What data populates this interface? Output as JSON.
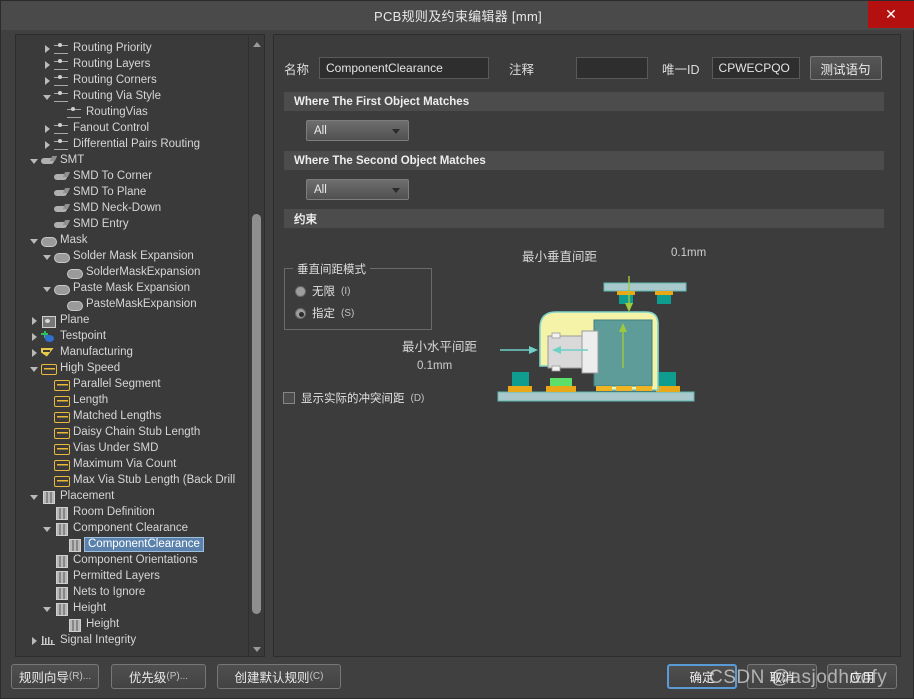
{
  "window": {
    "title": "PCB规则及约束编辑器 [mm]",
    "close_label": "✕"
  },
  "tree": {
    "items": [
      {
        "label": "Routing Priority",
        "indent": 3,
        "arrow": "closed",
        "icon": "route"
      },
      {
        "label": "Routing Layers",
        "indent": 3,
        "arrow": "closed",
        "icon": "route"
      },
      {
        "label": "Routing Corners",
        "indent": 3,
        "arrow": "closed",
        "icon": "route"
      },
      {
        "label": "Routing Via Style",
        "indent": 3,
        "arrow": "open",
        "icon": "route"
      },
      {
        "label": "RoutingVias",
        "indent": 4,
        "arrow": "none",
        "icon": "route"
      },
      {
        "label": "Fanout Control",
        "indent": 3,
        "arrow": "closed",
        "icon": "route"
      },
      {
        "label": "Differential Pairs Routing",
        "indent": 3,
        "arrow": "closed",
        "icon": "route"
      },
      {
        "label": "SMT",
        "indent": 2,
        "arrow": "open",
        "icon": "smd"
      },
      {
        "label": "SMD To Corner",
        "indent": 3,
        "arrow": "none",
        "icon": "smd"
      },
      {
        "label": "SMD To Plane",
        "indent": 3,
        "arrow": "none",
        "icon": "smd"
      },
      {
        "label": "SMD Neck-Down",
        "indent": 3,
        "arrow": "none",
        "icon": "smd"
      },
      {
        "label": "SMD Entry",
        "indent": 3,
        "arrow": "none",
        "icon": "smd"
      },
      {
        "label": "Mask",
        "indent": 2,
        "arrow": "open",
        "icon": "mask"
      },
      {
        "label": "Solder Mask Expansion",
        "indent": 3,
        "arrow": "open",
        "icon": "mask"
      },
      {
        "label": "SolderMaskExpansion",
        "indent": 4,
        "arrow": "none",
        "icon": "mask"
      },
      {
        "label": "Paste Mask Expansion",
        "indent": 3,
        "arrow": "open",
        "icon": "mask"
      },
      {
        "label": "PasteMaskExpansion",
        "indent": 4,
        "arrow": "none",
        "icon": "mask"
      },
      {
        "label": "Plane",
        "indent": 2,
        "arrow": "closed",
        "icon": "plane"
      },
      {
        "label": "Testpoint",
        "indent": 2,
        "arrow": "closed",
        "icon": "testpoint"
      },
      {
        "label": "Manufacturing",
        "indent": 2,
        "arrow": "closed",
        "icon": "manu"
      },
      {
        "label": "High Speed",
        "indent": 2,
        "arrow": "open",
        "icon": "hs"
      },
      {
        "label": "Parallel Segment",
        "indent": 3,
        "arrow": "none",
        "icon": "hs"
      },
      {
        "label": "Length",
        "indent": 3,
        "arrow": "none",
        "icon": "hs"
      },
      {
        "label": "Matched Lengths",
        "indent": 3,
        "arrow": "none",
        "icon": "hs"
      },
      {
        "label": "Daisy Chain Stub Length",
        "indent": 3,
        "arrow": "none",
        "icon": "hs"
      },
      {
        "label": "Vias Under SMD",
        "indent": 3,
        "arrow": "none",
        "icon": "hs"
      },
      {
        "label": "Maximum Via Count",
        "indent": 3,
        "arrow": "none",
        "icon": "hs"
      },
      {
        "label": "Max Via Stub Length (Back Drill",
        "indent": 3,
        "arrow": "none",
        "icon": "hs"
      },
      {
        "label": "Placement",
        "indent": 2,
        "arrow": "open",
        "icon": "place"
      },
      {
        "label": "Room Definition",
        "indent": 3,
        "arrow": "none",
        "icon": "place"
      },
      {
        "label": "Component Clearance",
        "indent": 3,
        "arrow": "open",
        "icon": "place"
      },
      {
        "label": "ComponentClearance",
        "indent": 4,
        "arrow": "none",
        "icon": "place",
        "selected": true
      },
      {
        "label": "Component Orientations",
        "indent": 3,
        "arrow": "none",
        "icon": "place"
      },
      {
        "label": "Permitted Layers",
        "indent": 3,
        "arrow": "none",
        "icon": "place"
      },
      {
        "label": "Nets to Ignore",
        "indent": 3,
        "arrow": "none",
        "icon": "place"
      },
      {
        "label": "Height",
        "indent": 3,
        "arrow": "open",
        "icon": "place"
      },
      {
        "label": "Height",
        "indent": 4,
        "arrow": "none",
        "icon": "place"
      },
      {
        "label": "Signal Integrity",
        "indent": 2,
        "arrow": "closed",
        "icon": "si"
      }
    ]
  },
  "form": {
    "name_label": "名称",
    "name_value": "ComponentClearance",
    "comment_label": "注释",
    "comment_value": "",
    "uid_label": "唯一ID",
    "uid_value": "CPWECPQO",
    "test_button": "测试语句"
  },
  "sections": {
    "first_match_title": "Where The First Object Matches",
    "first_match_value": "All",
    "second_match_title": "Where The Second Object Matches",
    "second_match_value": "All",
    "constraints_title": "约束"
  },
  "constraints": {
    "mode_legend": "垂直间距模式",
    "radio_infinite": "无限",
    "radio_infinite_mn": "(I)",
    "radio_specified": "指定",
    "radio_specified_mn": "(S)",
    "show_actual_label": "显示实际的冲突间距",
    "show_actual_mn": "(D)",
    "vertical_label": "最小垂直间距",
    "vertical_value": "0.1mm",
    "horizontal_label": "最小水平间距",
    "horizontal_value": "0.1mm"
  },
  "footer": {
    "rule_wizard": "规则向导",
    "rule_wizard_mn": "(R)...",
    "priority": "优先级",
    "priority_mn": "(P)...",
    "create_default": "创建默认规则",
    "create_default_mn": "(C)",
    "ok": "确定",
    "cancel": "取消",
    "apply": "应用",
    "watermark": "CSDN @asjodhoofy"
  }
}
